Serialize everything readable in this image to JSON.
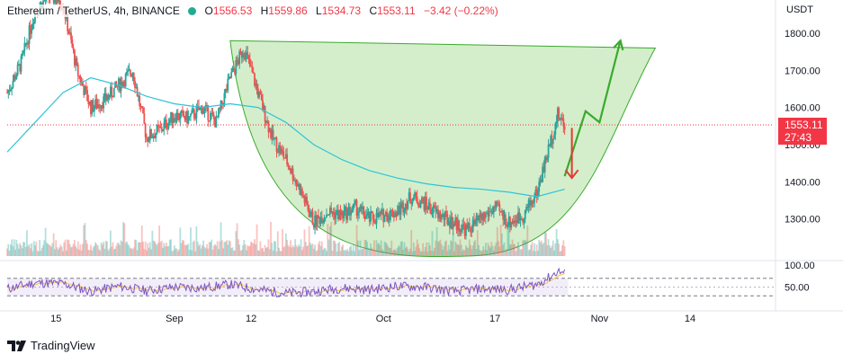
{
  "header": {
    "symbol": "Ethereum / TetherUS, 4h, BINANCE",
    "o_label": "O",
    "o_value": "1556.53",
    "h_label": "H",
    "h_value": "1559.86",
    "l_label": "L",
    "l_value": "1534.73",
    "c_label": "C",
    "c_value": "1553.11",
    "change": "−3.42 (−0.22%)"
  },
  "price_label": {
    "price": "1553.11",
    "countdown": "27:43"
  },
  "brand": "TradingView",
  "colors": {
    "up": "#26a69a",
    "down": "#ef5350",
    "ma": "#2ec4d6",
    "cup_fill": "#b7e2a8",
    "green_arrow": "#3aaa2c",
    "red_arrow": "#e53935",
    "rsi_line": "#7e57c2",
    "rsi_signal": "#f5c342",
    "price_line": "#f23645"
  },
  "chart_data": [
    {
      "type": "candlestick",
      "title": "Ethereum / TetherUS, 4h, BINANCE",
      "unit": "USDT",
      "ylim": [
        1200,
        1870
      ],
      "y_ticks": [
        1300,
        1400,
        1500,
        1600,
        1700,
        1800
      ],
      "y_tick_labels": [
        "1300.00",
        "1400.00",
        "1500.00",
        "1600.00",
        "1700.00",
        "1800.00"
      ],
      "x_ticks": [
        "15",
        "Sep",
        "12",
        "Oct",
        "17",
        "Nov",
        "14"
      ],
      "last_price": 1553.11,
      "price_path": [
        [
          "2022-08-08",
          1640
        ],
        [
          "2022-08-10",
          1720
        ],
        [
          "2022-08-12",
          1860
        ],
        [
          "2022-08-14",
          1900
        ],
        [
          "2022-08-16",
          1880
        ],
        [
          "2022-08-18",
          1700
        ],
        [
          "2022-08-20",
          1600
        ],
        [
          "2022-08-22",
          1620
        ],
        [
          "2022-08-24",
          1660
        ],
        [
          "2022-08-26",
          1700
        ],
        [
          "2022-08-28",
          1520
        ],
        [
          "2022-08-30",
          1540
        ],
        [
          "2022-09-01",
          1580
        ],
        [
          "2022-09-03",
          1570
        ],
        [
          "2022-09-05",
          1600
        ],
        [
          "2022-09-07",
          1560
        ],
        [
          "2022-09-09",
          1680
        ],
        [
          "2022-09-11",
          1760
        ],
        [
          "2022-09-13",
          1640
        ],
        [
          "2022-09-15",
          1520
        ],
        [
          "2022-09-17",
          1460
        ],
        [
          "2022-09-19",
          1380
        ],
        [
          "2022-09-21",
          1290
        ],
        [
          "2022-09-23",
          1320
        ],
        [
          "2022-09-25",
          1310
        ],
        [
          "2022-09-27",
          1330
        ],
        [
          "2022-09-29",
          1300
        ],
        [
          "2022-10-01",
          1310
        ],
        [
          "2022-10-03",
          1320
        ],
        [
          "2022-10-05",
          1360
        ],
        [
          "2022-10-07",
          1340
        ],
        [
          "2022-10-09",
          1310
        ],
        [
          "2022-10-11",
          1290
        ],
        [
          "2022-10-13",
          1270
        ],
        [
          "2022-10-15",
          1300
        ],
        [
          "2022-10-17",
          1330
        ],
        [
          "2022-10-19",
          1290
        ],
        [
          "2022-10-21",
          1310
        ],
        [
          "2022-10-23",
          1370
        ],
        [
          "2022-10-25",
          1510
        ],
        [
          "2022-10-26",
          1580
        ],
        [
          "2022-10-27",
          1553.11
        ]
      ],
      "moving_average": [
        [
          "2022-08-08",
          1480
        ],
        [
          "2022-08-12",
          1560
        ],
        [
          "2022-08-16",
          1640
        ],
        [
          "2022-08-20",
          1680
        ],
        [
          "2022-08-24",
          1660
        ],
        [
          "2022-08-28",
          1630
        ],
        [
          "2022-09-01",
          1610
        ],
        [
          "2022-09-05",
          1600
        ],
        [
          "2022-09-09",
          1610
        ],
        [
          "2022-09-13",
          1600
        ],
        [
          "2022-09-17",
          1560
        ],
        [
          "2022-09-21",
          1500
        ],
        [
          "2022-09-25",
          1460
        ],
        [
          "2022-09-29",
          1430
        ],
        [
          "2022-10-03",
          1410
        ],
        [
          "2022-10-07",
          1395
        ],
        [
          "2022-10-11",
          1385
        ],
        [
          "2022-10-15",
          1380
        ],
        [
          "2022-10-19",
          1372
        ],
        [
          "2022-10-23",
          1360
        ],
        [
          "2022-10-27",
          1380
        ]
      ],
      "pattern": {
        "type": "cup",
        "rim_left": [
          "2022-09-09",
          1780
        ],
        "bottom": [
          "2022-10-13",
          1200
        ],
        "rim_right": [
          "2022-11-09",
          1760
        ],
        "green_arrow_path": [
          [
            "2022-10-27",
            1415
          ],
          [
            "2022-10-30",
            1590
          ],
          [
            "2022-11-01",
            1560
          ],
          [
            "2022-11-04",
            1780
          ]
        ],
        "red_arrow": [
          [
            "2022-10-27",
            1545
          ],
          [
            "2022-10-27",
            1410
          ]
        ]
      }
    },
    {
      "type": "line",
      "title": "",
      "ylim": [
        0,
        100
      ],
      "y_ticks": [
        50,
        100
      ],
      "y_tick_labels": [
        "50.00",
        "100.00"
      ],
      "bands": [
        30,
        70
      ],
      "rsi": [
        [
          "2022-08-08",
          46
        ],
        [
          "2022-08-12",
          60
        ],
        [
          "2022-08-16",
          58
        ],
        [
          "2022-08-20",
          40
        ],
        [
          "2022-08-24",
          52
        ],
        [
          "2022-08-28",
          42
        ],
        [
          "2022-09-01",
          50
        ],
        [
          "2022-09-05",
          48
        ],
        [
          "2022-09-09",
          56
        ],
        [
          "2022-09-13",
          44
        ],
        [
          "2022-09-17",
          36
        ],
        [
          "2022-09-21",
          40
        ],
        [
          "2022-09-25",
          48
        ],
        [
          "2022-09-29",
          44
        ],
        [
          "2022-10-03",
          52
        ],
        [
          "2022-10-07",
          50
        ],
        [
          "2022-10-11",
          40
        ],
        [
          "2022-10-15",
          46
        ],
        [
          "2022-10-19",
          44
        ],
        [
          "2022-10-23",
          56
        ],
        [
          "2022-10-25",
          74
        ],
        [
          "2022-10-26",
          86
        ],
        [
          "2022-10-27",
          82
        ]
      ]
    }
  ]
}
